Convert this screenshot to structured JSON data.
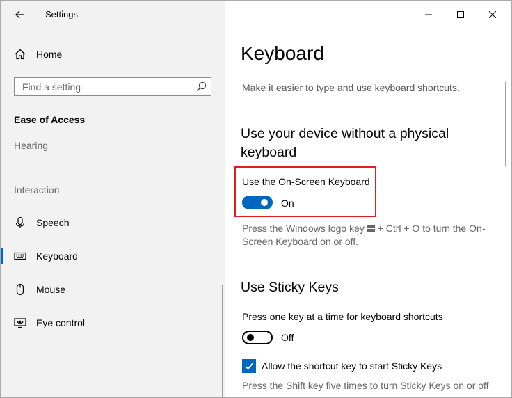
{
  "window": {
    "title": "Settings"
  },
  "sidebar": {
    "home_label": "Home",
    "search": {
      "placeholder": "Find a setting",
      "value": ""
    },
    "section_title": "Ease of Access",
    "groups": [
      {
        "label": "Hearing"
      },
      {
        "label": "Interaction"
      }
    ],
    "items": [
      {
        "label": "Speech",
        "icon": "microphone-icon"
      },
      {
        "label": "Keyboard",
        "icon": "keyboard-icon",
        "active": true
      },
      {
        "label": "Mouse",
        "icon": "mouse-icon"
      },
      {
        "label": "Eye control",
        "icon": "eye-control-icon"
      }
    ]
  },
  "main": {
    "title": "Keyboard",
    "description": "Make it easier to type and use keyboard shortcuts.",
    "sections": [
      {
        "heading": "Use your device without a physical keyboard",
        "setting_label": "Use the On-Screen Keyboard",
        "toggle_state": "On",
        "help_text_before": "Press the Windows logo key",
        "help_text_after": "+ Ctrl + O to turn the On-Screen Keyboard on or off."
      },
      {
        "heading": "Use Sticky Keys",
        "setting_label": "Press one key at a time for keyboard shortcuts",
        "toggle_state": "Off",
        "checkbox_label": "Allow the shortcut key to start Sticky Keys",
        "help_text": "Press the Shift key five times to turn Sticky Keys on or off"
      }
    ]
  },
  "colors": {
    "accent": "#0067c0",
    "highlight": "#e02020",
    "sidebar_bg": "#f2f2f2"
  }
}
